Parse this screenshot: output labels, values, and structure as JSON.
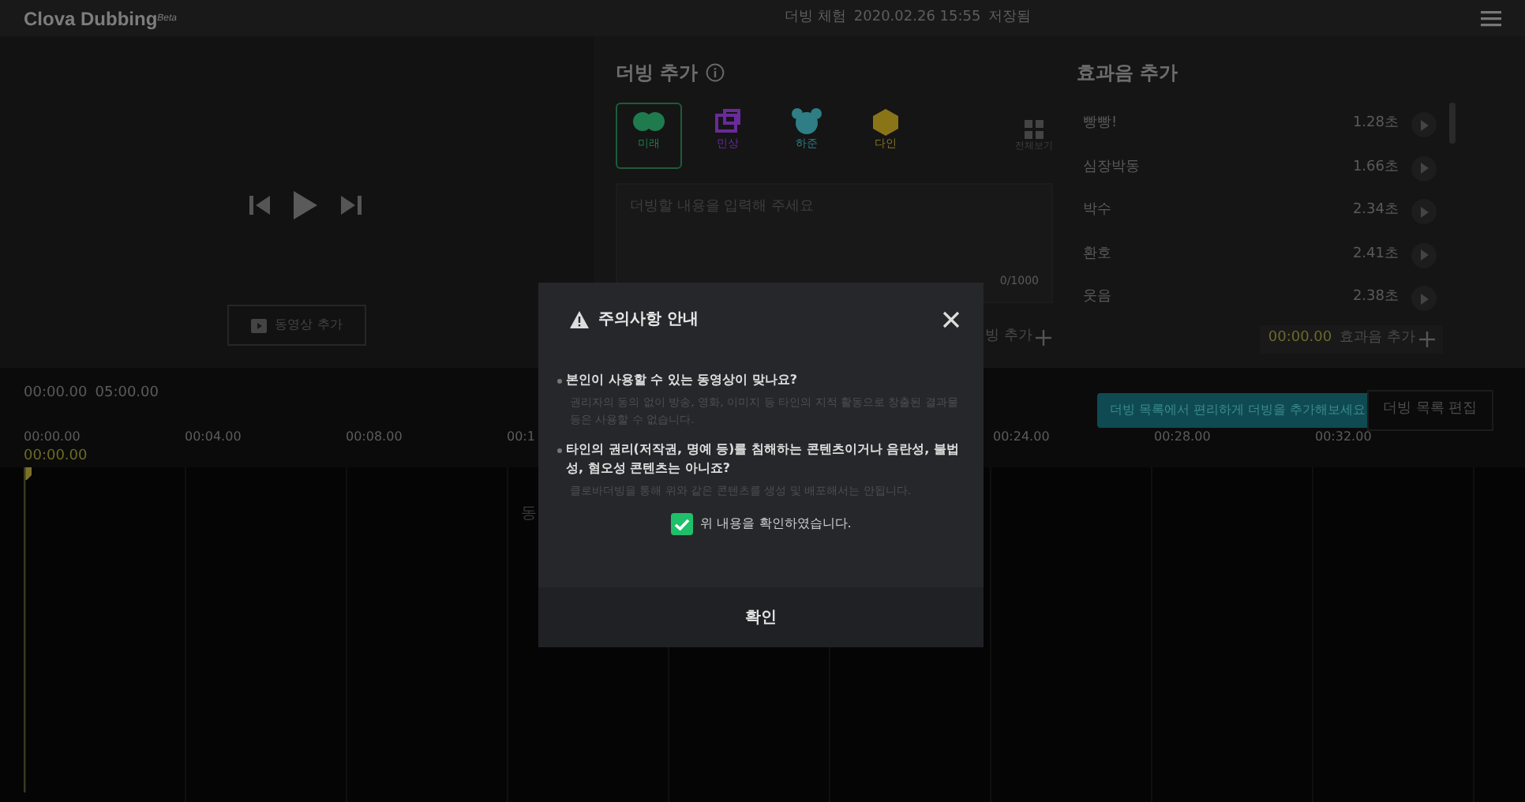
{
  "header": {
    "logo": "Clova Dubbing",
    "logo_sup": "Beta",
    "mode": "더빙 체험",
    "datetime": "2020.02.26 15:55",
    "save_status": "저장됨"
  },
  "player": {
    "add_video": "동영상 추가"
  },
  "dubbing": {
    "title": "더빙 추가",
    "voices": [
      {
        "name": "미래",
        "kind": "blob",
        "color": "#1f7a4d",
        "selected": true
      },
      {
        "name": "민상",
        "kind": "frame",
        "color": "#6a2a9a",
        "selected": false
      },
      {
        "name": "하준",
        "kind": "bear",
        "color": "#2f7e86",
        "selected": false
      },
      {
        "name": "다인",
        "kind": "hexagon",
        "color": "#8a7418",
        "selected": false
      }
    ],
    "view_all": "전체보기",
    "placeholder": "더빙할 내용을 입력해 주세요",
    "counter": "0/1000",
    "add_button": "빙 추가"
  },
  "effects": {
    "title": "효과음 추가",
    "items": [
      {
        "name": "빵빵!",
        "duration": "1.28초"
      },
      {
        "name": "심장박동",
        "duration": "1.66초"
      },
      {
        "name": "박수",
        "duration": "2.34초"
      },
      {
        "name": "환호",
        "duration": "2.41초"
      },
      {
        "name": "웃음",
        "duration": "2.38초"
      }
    ],
    "time": "00:00.00",
    "add_button": "효과음 추가"
  },
  "timeline": {
    "current": "00:00.00",
    "total": "05:00.00",
    "ticks_left": [
      "00:00.00",
      "00:04.00",
      "00:08.00",
      "00:1"
    ],
    "ticks_right": [
      "00:24.00",
      "00:28.00",
      "00:32.00"
    ],
    "playhead": "00:00.00",
    "hint_partial": "동",
    "tooltip": "더빙 목록에서 편리하게 더빙을 추가해보세요",
    "edit_list": "더빙 목록 편집"
  },
  "dialog": {
    "title": "주의사항 안내",
    "items": [
      {
        "question": "본인이 사용할 수 있는 동영상이 맞나요?",
        "note": "권리자의 동의 없이 방송, 영화, 이미지 등 타인의 지적 활동으로 창출된 결과물 등은 사용할 수 없습니다."
      },
      {
        "question": "타인의 권리(저작권, 명예 등)를 침해하는 콘텐츠이거나 음란성, 불법성, 혐오성 콘텐츠는 아니죠?",
        "note": "클로바더빙을 통해 위와 같은 콘텐츠를 생성 및 배포해서는 안됩니다."
      }
    ],
    "confirm_label": "위 내용을 확인하였습니다.",
    "checked": true,
    "button": "확인"
  }
}
